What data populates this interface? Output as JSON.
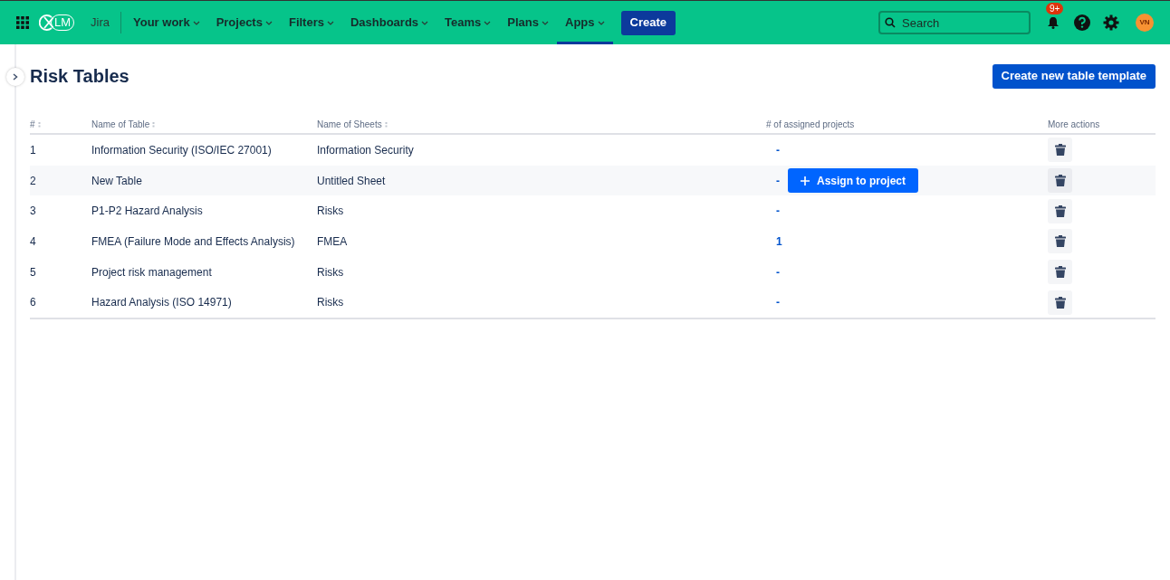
{
  "topbar": {
    "logo_text": "LM",
    "product": "Jira",
    "nav": [
      {
        "label": "Your work",
        "selected": false
      },
      {
        "label": "Projects",
        "selected": false
      },
      {
        "label": "Filters",
        "selected": false
      },
      {
        "label": "Dashboards",
        "selected": false
      },
      {
        "label": "Teams",
        "selected": false
      },
      {
        "label": "Plans",
        "selected": false
      },
      {
        "label": "Apps",
        "selected": true
      }
    ],
    "create": "Create",
    "search": {
      "placeholder": "Search"
    },
    "notifications_badge": "9+",
    "avatar": "VN"
  },
  "page": {
    "title": "Risk Tables",
    "create_button": "Create new table template"
  },
  "table": {
    "columns": [
      {
        "label": "#",
        "sortable": true
      },
      {
        "label": "Name of Table",
        "sortable": true
      },
      {
        "label": "Name of Sheets",
        "sortable": true
      },
      {
        "label": "# of assigned projects",
        "sortable": false
      },
      {
        "label": "More actions",
        "sortable": false
      }
    ],
    "assign_button": "Assign to project",
    "rows": [
      {
        "index": "1",
        "name": "Information Security (ISO/IEC 27001)",
        "sheets": "Information Security",
        "assigned": "-",
        "hovered": false
      },
      {
        "index": "2",
        "name": "New Table",
        "sheets": "Untitled Sheet",
        "assigned": "-",
        "hovered": true
      },
      {
        "index": "3",
        "name": "P1-P2 Hazard Analysis",
        "sheets": "Risks",
        "assigned": "-",
        "hovered": false
      },
      {
        "index": "4",
        "name": "FMEA (Failure Mode and Effects Analysis)",
        "sheets": "FMEA",
        "assigned": "1",
        "hovered": false
      },
      {
        "index": "5",
        "name": "Project risk management",
        "sheets": "Risks",
        "assigned": "-",
        "hovered": false
      },
      {
        "index": "6",
        "name": "Hazard Analysis (ISO 14971)",
        "sheets": "Risks",
        "assigned": "-",
        "hovered": false
      }
    ]
  }
}
